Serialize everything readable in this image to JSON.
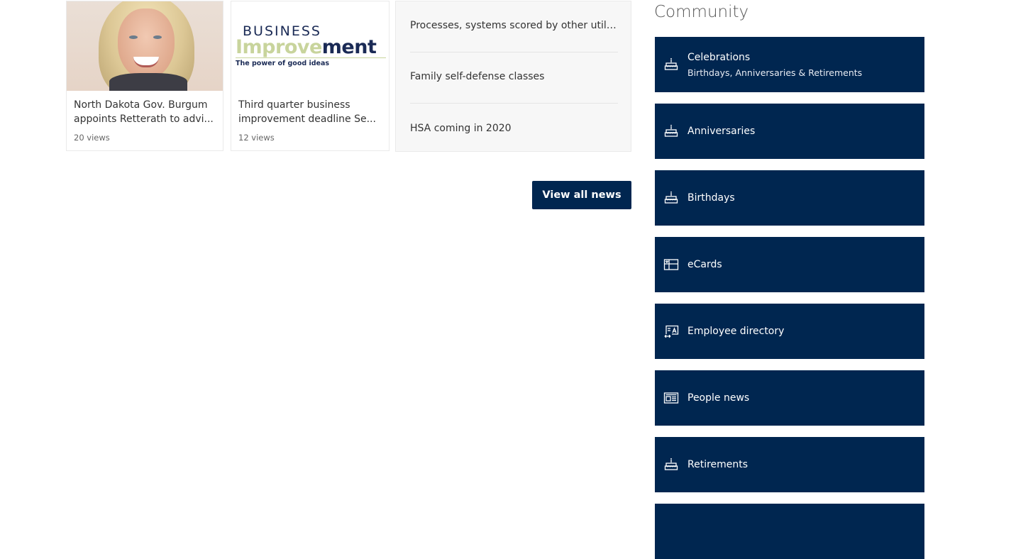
{
  "news": {
    "cards": [
      {
        "image": "portrait-photo",
        "title_line1": "North Dakota Gov. Burgum",
        "title_line2": "appoints Retterath to advi...",
        "views": "20 views"
      },
      {
        "image": "business-improvement-logo",
        "logo_line1": "BUSINESS",
        "logo_line2_a": "Improve",
        "logo_line2_b": "ment",
        "logo_tagline": "The power of good ideas",
        "title_line1": "Third quarter business",
        "title_line2": "improvement deadline Se...",
        "views": "12 views"
      }
    ],
    "list": [
      "Processes, systems scored by other utiliti...",
      "Family self-defense classes",
      "HSA coming in 2020"
    ],
    "view_all_label": "View all news"
  },
  "community": {
    "title": "Community",
    "accent_color": "#002650",
    "tiles": [
      {
        "icon": "cake-icon",
        "label": "Celebrations",
        "sublabel": "Birthdays, Anniversaries & Retirements"
      },
      {
        "icon": "cake-icon",
        "label": "Anniversaries"
      },
      {
        "icon": "cake-icon",
        "label": "Birthdays"
      },
      {
        "icon": "ecard-icon",
        "label": "eCards"
      },
      {
        "icon": "contact-card-icon",
        "label": "Employee directory"
      },
      {
        "icon": "newspaper-icon",
        "label": "People news"
      },
      {
        "icon": "cake-icon",
        "label": "Retirements"
      },
      {
        "icon": "",
        "label": ""
      }
    ]
  }
}
